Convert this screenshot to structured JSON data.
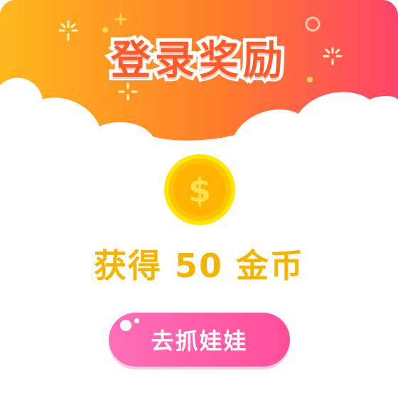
{
  "header": {
    "title": "登录奖励",
    "gradient_start": "#ffb21e",
    "gradient_mid": "#ff7a2c",
    "gradient_end": "#ff4a6a"
  },
  "coin": {
    "icon": "dollar-coin-icon",
    "symbol": "$",
    "color": "#ffc400"
  },
  "reward": {
    "text": "获得 50 金币",
    "color": "#f5b400"
  },
  "action": {
    "button_label": "去抓娃娃",
    "color": "#ff5aa8"
  }
}
